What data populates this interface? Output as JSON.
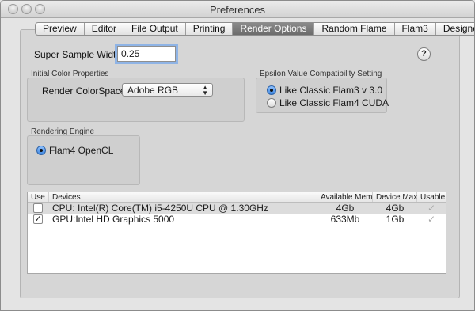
{
  "window": {
    "title": "Preferences"
  },
  "tabs": [
    {
      "label": "Preview"
    },
    {
      "label": "Editor"
    },
    {
      "label": "File Output"
    },
    {
      "label": "Printing"
    },
    {
      "label": "Render Options"
    },
    {
      "label": "Random Flame"
    },
    {
      "label": "Flam3"
    },
    {
      "label": "Designer"
    }
  ],
  "active_tab": "Render Options",
  "super_sample": {
    "label": "Super Sample Width",
    "value": "0.25"
  },
  "help_button": {
    "label": "?"
  },
  "initial_color": {
    "title": "Initial Color Properties",
    "colorspace_label": "Render ColorSpace",
    "colorspace_value": "Adobe RGB"
  },
  "epsilon": {
    "title": "Epsilon Value Compatibility Setting",
    "options": [
      {
        "label": "Like Classic Flam3 v 3.0",
        "selected": true
      },
      {
        "label": "Like Classic Flam4 CUDA",
        "selected": false
      }
    ]
  },
  "engine": {
    "title": "Rendering Engine",
    "options": [
      {
        "label": "Flam4 OpenCL",
        "selected": true
      }
    ]
  },
  "devices_table": {
    "columns": [
      "Use",
      "Devices",
      "Available Mem",
      "Device Max",
      "Usable"
    ],
    "rows": [
      {
        "use": false,
        "device": "CPU: Intel(R) Core(TM) i5-4250U CPU @ 1.30GHz",
        "available_mem": "4Gb",
        "device_max": "4Gb",
        "usable": true
      },
      {
        "use": true,
        "device": "GPU:Intel HD Graphics 5000",
        "available_mem": "633Mb",
        "device_max": "1Gb",
        "usable": true
      }
    ]
  }
}
